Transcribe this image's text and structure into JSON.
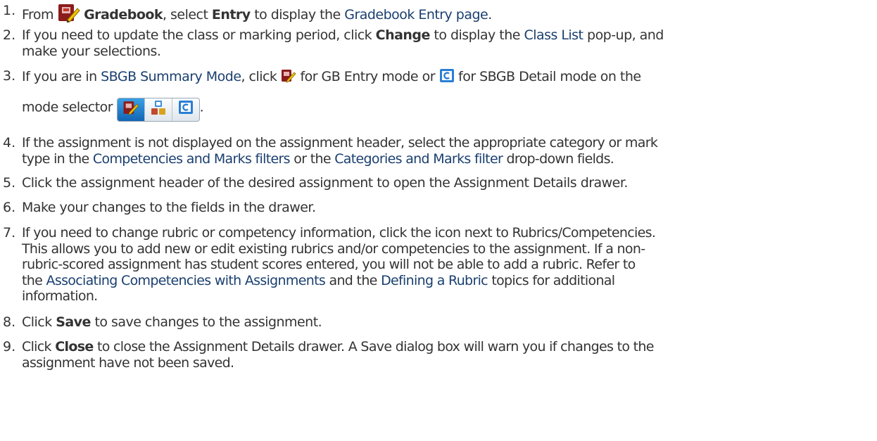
{
  "steps": [
    {
      "number": "1.",
      "parts": [
        "From",
        "Gradebook",
        ", select",
        "Entry",
        "to display the",
        "Gradebook Entry page",
        "."
      ]
    },
    {
      "number": "2.",
      "lines": [
        [
          "If you need to update the class or marking period, click",
          "Change",
          "to display the",
          "Class List",
          "pop-up, and"
        ],
        [
          "make your selections."
        ]
      ]
    },
    {
      "number": "3.",
      "lines": [
        [
          "If you are in",
          "SBGB Summary Mode",
          ", click",
          "for GB Entry mode or",
          "for SBGB Detail mode on the"
        ],
        [
          "mode selector",
          "."
        ]
      ]
    },
    {
      "number": "4.",
      "lines": [
        [
          "If the assignment is not displayed on the assignment header, select the appropriate category or mark"
        ],
        [
          "type in the",
          "Competencies and Marks filters",
          "or the",
          "Categories and Marks filter",
          "drop-down fields."
        ]
      ]
    },
    {
      "number": "5.",
      "text": "Click the assignment header of the desired assignment to open the Assignment Details drawer."
    },
    {
      "number": "6.",
      "text": "Make your changes to the fields in the drawer."
    },
    {
      "number": "7.",
      "lines": [
        [
          "If you need to change rubric or competency information, click the icon next to Rubrics/Competencies."
        ],
        [
          "This allows you to add new or edit existing rubrics and/or competencies to the assignment. If a non-"
        ],
        [
          "rubric-scored assignment has student scores entered, you will not be able to add a rubric. Refer to"
        ],
        [
          "the",
          "Associating Competencies with Assignments",
          "and the",
          "Defining a Rubric",
          "topics for additional"
        ],
        [
          "information."
        ]
      ]
    },
    {
      "number": "8.",
      "parts": [
        "Click",
        "Save",
        "to save changes to the assignment."
      ]
    },
    {
      "number": "9.",
      "lines": [
        [
          "Click",
          "Close",
          "to close the Assignment Details drawer. A Save dialog box will warn you if changes to the"
        ],
        [
          "assignment have not been saved."
        ]
      ]
    }
  ],
  "icons": {
    "gradebook": "gradebook-icon",
    "gb_entry_mode": "gb-entry-mode-icon",
    "sbgb_detail_mode": "sbgb-detail-mode-icon",
    "sbgb_summary_mode": "sbgb-summary-mode-icon"
  },
  "colors": {
    "text": "#333333",
    "link": "#1a3f6f",
    "mode_active": "#1f7ed0"
  }
}
